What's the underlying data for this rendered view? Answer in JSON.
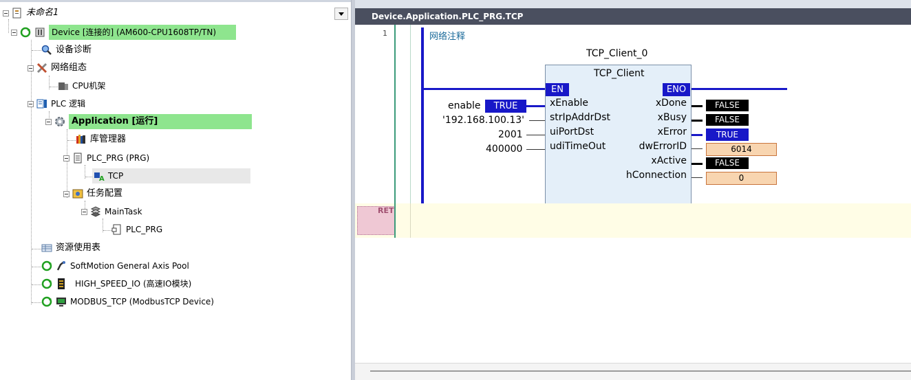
{
  "tree": {
    "root_label": "未命名1",
    "items": [
      {
        "label": "Device [连接的] (AM600-CPU1608TP/TN)"
      },
      {
        "label": "设备诊断"
      },
      {
        "label": "网络组态"
      },
      {
        "label": "CPU机架"
      },
      {
        "label": "PLC 逻辑"
      },
      {
        "label": "Application [运行]"
      },
      {
        "label": "库管理器"
      },
      {
        "label": "PLC_PRG (PRG)"
      },
      {
        "label": "TCP"
      },
      {
        "label": "任务配置"
      },
      {
        "label": "MainTask"
      },
      {
        "label": "PLC_PRG"
      },
      {
        "label": "资源使用表"
      },
      {
        "label": "SoftMotion General Axis Pool"
      },
      {
        "label": "HIGH_SPEED_IO (高速IO模块)"
      },
      {
        "label": "MODBUS_TCP (ModbusTCP Device)"
      }
    ]
  },
  "editor": {
    "title": "Device.Application.PLC_PRG.TCP",
    "rung_number": "1",
    "network_comment": "网络注释",
    "ret_label": "RET",
    "fb": {
      "instance": "TCP_Client_0",
      "type": "TCP_Client",
      "en": "EN",
      "eno": "ENO",
      "inputs": [
        "xEnable",
        "strIpAddrDst",
        "uiPortDst",
        "udiTimeOut"
      ],
      "outputs": [
        "xDone",
        "xBusy",
        "xError",
        "dwErrorID",
        "xActive",
        "hConnection"
      ]
    },
    "input_values": {
      "enable_var": "enable",
      "enable_val": "TRUE",
      "ip": "'192.168.100.13'",
      "port": "2001",
      "timeout": "400000"
    },
    "output_values": {
      "xDone": "FALSE",
      "xBusy": "FALSE",
      "xError": "TRUE",
      "dwErrorID": "6014",
      "xActive": "FALSE",
      "hConnection": "0"
    }
  },
  "colors": {
    "device_highlight": "#8ee58e",
    "power_rail": "#1818c8",
    "title_bar": "#4a4f5f"
  }
}
